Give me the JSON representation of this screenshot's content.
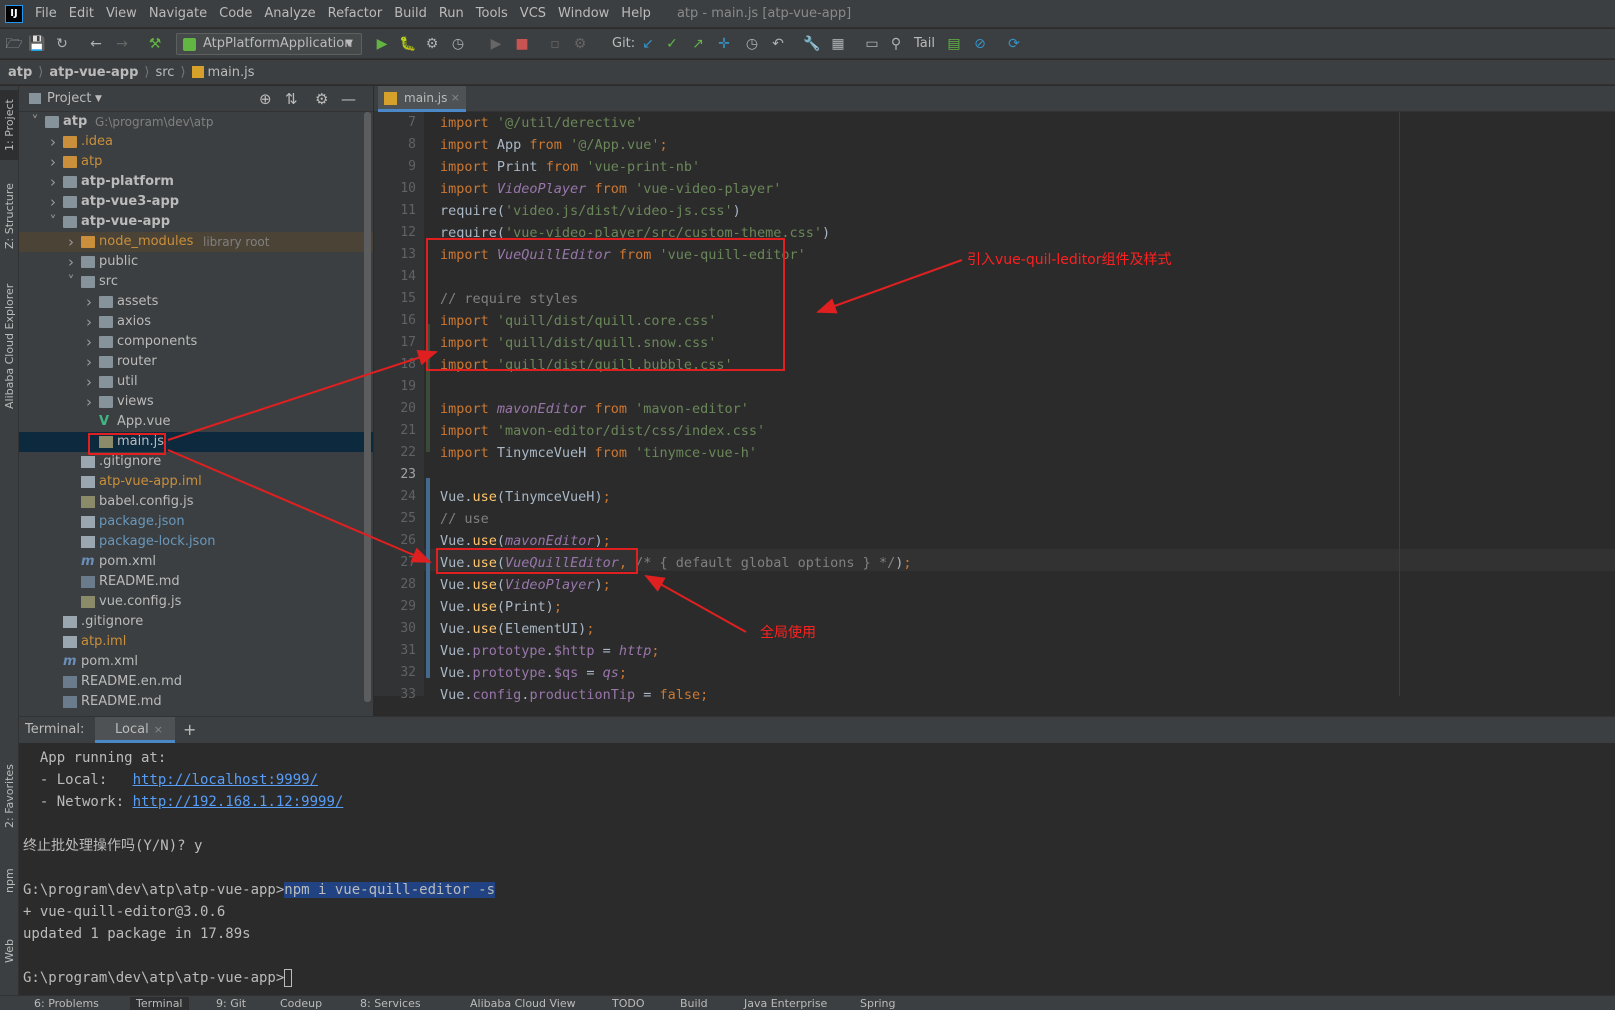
{
  "menubar": {
    "logo": "IJ",
    "items": [
      "File",
      "Edit",
      "View",
      "Navigate",
      "Code",
      "Analyze",
      "Refactor",
      "Build",
      "Run",
      "Tools",
      "VCS",
      "Window",
      "Help"
    ],
    "window_title": "atp - main.js [atp-vue-app]"
  },
  "toolbar": {
    "run_config": "AtpPlatformApplication",
    "git_label": "Git:",
    "tail_label": "Tail"
  },
  "breadcrumb": [
    "atp",
    "atp-vue-app",
    "src",
    "main.js"
  ],
  "left_tabs": [
    "1: Project",
    "Z: Structure",
    "Alibaba Cloud Explorer",
    "2: Favorites",
    "npm",
    "Web"
  ],
  "project": {
    "title": "Project",
    "tree": [
      {
        "label": "atp",
        "suffix": "G:\\program\\dev\\atp",
        "depth": 0,
        "arrow": "v",
        "type": "folder",
        "bold": true
      },
      {
        "label": ".idea",
        "depth": 1,
        "arrow": ">",
        "type": "folder",
        "color": "#c98f3b"
      },
      {
        "label": "atp",
        "depth": 1,
        "arrow": ">",
        "type": "folder",
        "color": "#c98f3b"
      },
      {
        "label": "atp-platform",
        "depth": 1,
        "arrow": ">",
        "type": "folder",
        "bold": true
      },
      {
        "label": "atp-vue3-app",
        "depth": 1,
        "arrow": ">",
        "type": "folder",
        "bold": true
      },
      {
        "label": "atp-vue-app",
        "depth": 1,
        "arrow": "v",
        "type": "folder",
        "bold": true
      },
      {
        "label": "node_modules",
        "suffix": "library root",
        "depth": 2,
        "arrow": ">",
        "type": "folder",
        "color": "#c98f3b",
        "highlight": "#4b4336"
      },
      {
        "label": "public",
        "depth": 2,
        "arrow": ">",
        "type": "folder"
      },
      {
        "label": "src",
        "depth": 2,
        "arrow": "v",
        "type": "folder"
      },
      {
        "label": "assets",
        "depth": 3,
        "arrow": ">",
        "type": "folder"
      },
      {
        "label": "axios",
        "depth": 3,
        "arrow": ">",
        "type": "folder"
      },
      {
        "label": "components",
        "depth": 3,
        "arrow": ">",
        "type": "folder"
      },
      {
        "label": "router",
        "depth": 3,
        "arrow": ">",
        "type": "folder"
      },
      {
        "label": "util",
        "depth": 3,
        "arrow": ">",
        "type": "folder"
      },
      {
        "label": "views",
        "depth": 3,
        "arrow": ">",
        "type": "folder"
      },
      {
        "label": "App.vue",
        "depth": 3,
        "arrow": "",
        "type": "vue"
      },
      {
        "label": "main.js",
        "depth": 3,
        "arrow": "",
        "type": "js",
        "selected": true
      },
      {
        "label": ".gitignore",
        "depth": 2,
        "arrow": "",
        "type": "file"
      },
      {
        "label": "atp-vue-app.iml",
        "depth": 2,
        "arrow": "",
        "type": "file",
        "color": "#c98f3b"
      },
      {
        "label": "babel.config.js",
        "depth": 2,
        "arrow": "",
        "type": "js"
      },
      {
        "label": "package.json",
        "depth": 2,
        "arrow": "",
        "type": "file",
        "color": "#6897bb"
      },
      {
        "label": "package-lock.json",
        "depth": 2,
        "arrow": "",
        "type": "file",
        "color": "#6897bb"
      },
      {
        "label": "pom.xml",
        "depth": 2,
        "arrow": "",
        "type": "maven"
      },
      {
        "label": "README.md",
        "depth": 2,
        "arrow": "",
        "type": "md"
      },
      {
        "label": "vue.config.js",
        "depth": 2,
        "arrow": "",
        "type": "js"
      },
      {
        "label": ".gitignore",
        "depth": 1,
        "arrow": "",
        "type": "file"
      },
      {
        "label": "atp.iml",
        "depth": 1,
        "arrow": "",
        "type": "file",
        "color": "#c98f3b"
      },
      {
        "label": "pom.xml",
        "depth": 1,
        "arrow": "",
        "type": "maven"
      },
      {
        "label": "README.en.md",
        "depth": 1,
        "arrow": "",
        "type": "md"
      },
      {
        "label": "README.md",
        "depth": 1,
        "arrow": "",
        "type": "md"
      }
    ]
  },
  "editor": {
    "tab": "main.js",
    "line_numbers": [
      "7",
      "8",
      "9",
      "10",
      "11",
      "12",
      "13",
      "14",
      "15",
      "16",
      "17",
      "18",
      "19",
      "20",
      "21",
      "22",
      "23",
      "24",
      "25",
      "26",
      "27",
      "28",
      "29",
      "30",
      "31",
      "32",
      "33"
    ],
    "lines": [
      [
        [
          "kw",
          "import "
        ],
        [
          "st",
          "'@/util/derective'"
        ]
      ],
      [
        [
          "kw",
          "import "
        ],
        [
          "tx",
          "App "
        ],
        [
          "kw",
          "from "
        ],
        [
          "st",
          "'@/App.vue'"
        ],
        [
          "kw",
          ";"
        ]
      ],
      [
        [
          "kw",
          "import "
        ],
        [
          "tx",
          "Print "
        ],
        [
          "kw",
          "from "
        ],
        [
          "st",
          "'vue-print-nb'"
        ]
      ],
      [
        [
          "kw",
          "import "
        ],
        [
          "it",
          "VideoPlayer "
        ],
        [
          "kw",
          "from "
        ],
        [
          "st",
          "'vue-video-player'"
        ]
      ],
      [
        [
          "tx",
          "require("
        ],
        [
          "st",
          "'video.js/dist/video-js.css'"
        ],
        [
          "tx",
          ")"
        ]
      ],
      [
        [
          "tx",
          "require("
        ],
        [
          "st",
          "'vue-video-player/src/custom-theme.css'"
        ],
        [
          "tx",
          ")"
        ]
      ],
      [
        [
          "kw",
          "import "
        ],
        [
          "it",
          "VueQuillEditor "
        ],
        [
          "kw",
          "from "
        ],
        [
          "st",
          "'vue-quill-editor'"
        ]
      ],
      [
        [
          "tx",
          ""
        ]
      ],
      [
        [
          "cm",
          "// require styles"
        ]
      ],
      [
        [
          "kw",
          "import "
        ],
        [
          "st",
          "'quill/dist/quill.core.css'"
        ]
      ],
      [
        [
          "kw",
          "import "
        ],
        [
          "st",
          "'quill/dist/quill.snow.css'"
        ]
      ],
      [
        [
          "kw",
          "import "
        ],
        [
          "st",
          "'quill/dist/quill.bubble.css'"
        ]
      ],
      [
        [
          "tx",
          ""
        ]
      ],
      [
        [
          "kw",
          "import "
        ],
        [
          "it",
          "mavonEditor "
        ],
        [
          "kw",
          "from "
        ],
        [
          "st",
          "'mavon-editor'"
        ]
      ],
      [
        [
          "kw",
          "import "
        ],
        [
          "st",
          "'mavon-editor/dist/css/index.css'"
        ]
      ],
      [
        [
          "kw",
          "import "
        ],
        [
          "tx",
          "TinymceVueH "
        ],
        [
          "kw",
          "from "
        ],
        [
          "st",
          "'tinymce-vue-h'"
        ]
      ],
      [
        [
          "tx",
          ""
        ]
      ],
      [
        [
          "tx",
          "Vue."
        ],
        [
          "fn",
          "use"
        ],
        [
          "tx",
          "(TinymceVueH)"
        ],
        [
          "kw",
          ";"
        ]
      ],
      [
        [
          "cm",
          "// use"
        ]
      ],
      [
        [
          "tx",
          "Vue."
        ],
        [
          "fn",
          "use"
        ],
        [
          "tx",
          "("
        ],
        [
          "it",
          "mavonEditor"
        ],
        [
          "tx",
          ")"
        ],
        [
          "kw",
          ";"
        ]
      ],
      [
        [
          "tx",
          "Vue."
        ],
        [
          "fn",
          "use"
        ],
        [
          "tx",
          "("
        ],
        [
          "it",
          "VueQuillEditor"
        ],
        [
          "kw",
          ", "
        ],
        [
          "cm",
          "/* { default global options } */"
        ],
        [
          "tx",
          ")"
        ],
        [
          "kw",
          ";"
        ]
      ],
      [
        [
          "tx",
          "Vue."
        ],
        [
          "fn",
          "use"
        ],
        [
          "tx",
          "("
        ],
        [
          "it",
          "VideoPlayer"
        ],
        [
          "tx",
          ")"
        ],
        [
          "kw",
          ";"
        ]
      ],
      [
        [
          "tx",
          "Vue."
        ],
        [
          "fn",
          "use"
        ],
        [
          "tx",
          "(Print)"
        ],
        [
          "kw",
          ";"
        ]
      ],
      [
        [
          "tx",
          "Vue."
        ],
        [
          "fn",
          "use"
        ],
        [
          "tx",
          "(ElementUI)"
        ],
        [
          "kw",
          ";"
        ]
      ],
      [
        [
          "tx",
          "Vue."
        ],
        [
          "pr",
          "prototype"
        ],
        [
          "tx",
          "."
        ],
        [
          "pr",
          "$http"
        ],
        [
          "tx",
          " = "
        ],
        [
          "it",
          "http"
        ],
        [
          "kw",
          ";"
        ]
      ],
      [
        [
          "tx",
          "Vue."
        ],
        [
          "pr",
          "prototype"
        ],
        [
          "tx",
          "."
        ],
        [
          "pr",
          "$qs"
        ],
        [
          "tx",
          " = "
        ],
        [
          "it",
          "qs"
        ],
        [
          "kw",
          ";"
        ]
      ],
      [
        [
          "tx",
          "Vue."
        ],
        [
          "pr",
          "config"
        ],
        [
          "tx",
          "."
        ],
        [
          "pr",
          "productionTip"
        ],
        [
          "tx",
          " = "
        ],
        [
          "kw",
          "false;"
        ]
      ]
    ]
  },
  "annotations": {
    "import_note": "引入vue-quil-leditor组件及样式",
    "use_note": "全局使用"
  },
  "terminal": {
    "label": "Terminal:",
    "tab": "Local",
    "lines": [
      {
        "t": "  App running at:"
      },
      {
        "t": "  - Local:   ",
        "link": "http://localhost:9999/"
      },
      {
        "t": "  - Network: ",
        "link": "http://192.168.1.12:9999/"
      },
      {
        "t": ""
      },
      {
        "t": "终止批处理操作吗(Y/N)? y"
      },
      {
        "t": ""
      },
      {
        "t": "G:\\program\\dev\\atp\\atp-vue-app>",
        "sel": "npm i vue-quill-editor -s"
      },
      {
        "t": "+ vue-quill-editor@3.0.6"
      },
      {
        "t": "updated 1 package in 17.89s"
      },
      {
        "t": ""
      },
      {
        "t": "G:\\program\\dev\\atp\\atp-vue-app>",
        "cursor": true
      }
    ]
  },
  "statusbar": [
    "6: Problems",
    "Terminal",
    "9: Git",
    "Codeup",
    "8: Services",
    "Alibaba Cloud View",
    "TODO",
    "Build",
    "Java Enterprise",
    "Spring"
  ]
}
